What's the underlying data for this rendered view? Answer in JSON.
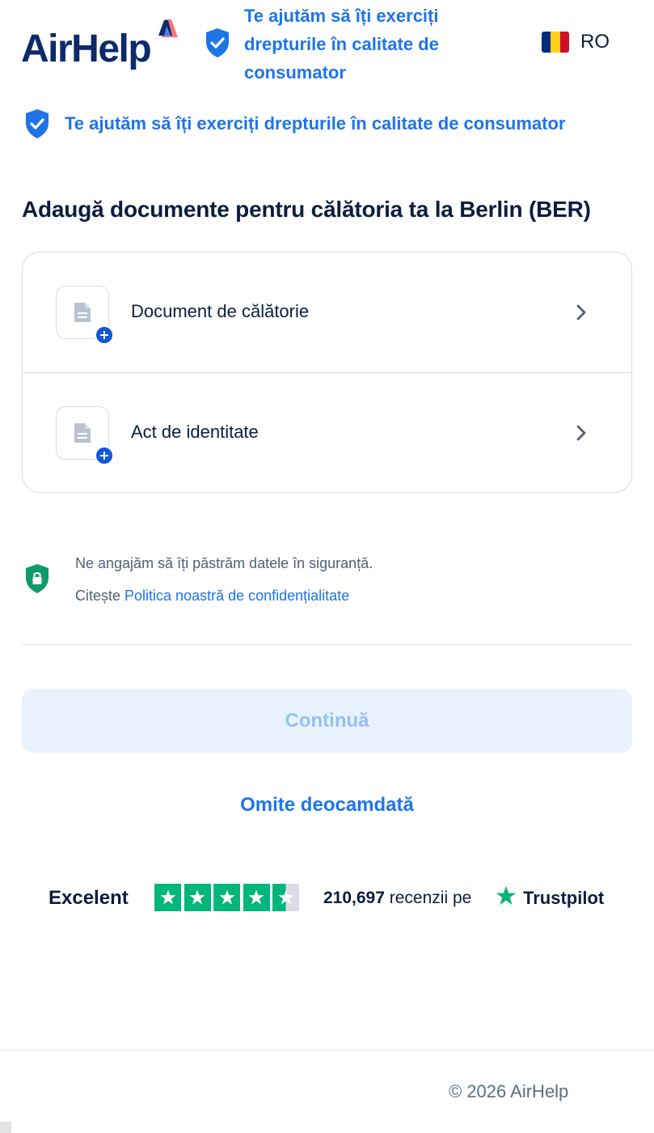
{
  "header": {
    "logo_text": "AirHelp",
    "claim": "Te ajutăm să îți exerciți drepturile în calitate de consumator",
    "language_code": "RO",
    "flag_colors": [
      "#002B7F",
      "#FCD116",
      "#CE1126"
    ]
  },
  "banner": {
    "text": "Te ajutăm să îți exerciți drepturile în calitate de consumator"
  },
  "page": {
    "title": "Adaugă documente pentru călătoria ta la Berlin (BER)"
  },
  "documents": [
    {
      "label": "Document de călătorie",
      "icon": "document-icon"
    },
    {
      "label": "Act de identitate",
      "icon": "document-icon"
    }
  ],
  "privacy": {
    "statement": "Ne angajăm să îți păstrăm datele în siguranță.",
    "read_prefix": "Citește ",
    "policy_link": "Politica noastră de confidențialitate"
  },
  "actions": {
    "continue_label": "Continuă",
    "skip_label": "Omite deocamdată"
  },
  "trustpilot": {
    "rating_label": "Excelent",
    "stars_filled": 4.5,
    "reviews_count": "210,697",
    "reviews_suffix": " recenzii pe",
    "brand": "Trustpilot"
  },
  "footer": {
    "copyright": "© 2026 AirHelp"
  },
  "colors": {
    "brand_blue": "#1f74e8",
    "navy": "#0b1e3f",
    "trustpilot_green": "#00b67a",
    "disabled_button_bg": "#e8f3fe",
    "disabled_button_text": "#95c1f3"
  }
}
